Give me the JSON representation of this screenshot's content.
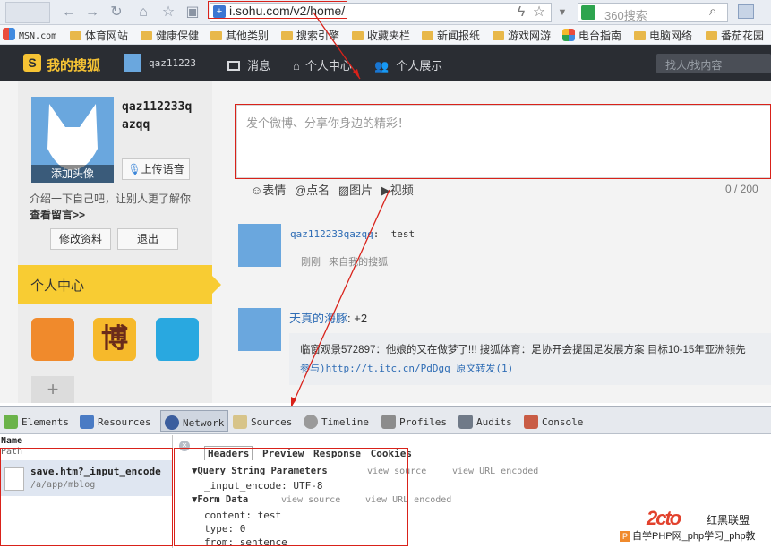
{
  "browser": {
    "url": "i.sohu.com/v2/home/",
    "search_placeholder": "360搜索"
  },
  "bookmarks": [
    "MSN.com",
    "体育网站",
    "健康保健",
    "其他类别",
    "搜索引擎",
    "收藏夹栏",
    "新闻报纸",
    "游戏网游",
    "电台指南",
    "电脑网络",
    "番茄花园"
  ],
  "sohu_nav": {
    "logo": "我的搜狐",
    "username": "qaz11223",
    "items": [
      "消息",
      "个人中心",
      "个人展示"
    ],
    "search_placeholder": "找人/找内容"
  },
  "profile": {
    "add_avatar": "添加头像",
    "name_line1": "qaz112233q",
    "name_line2": "azqq",
    "upload_voice": "上传语音",
    "intro": "介绍一下自己吧，让别人更了解你",
    "guestbook": "查看留言>>",
    "edit_profile": "修改资料",
    "logout": "退出",
    "personal_center": "个人中心"
  },
  "composer": {
    "placeholder": "发个微博、分享你身边的精彩！",
    "tools": [
      "表情",
      "点名",
      "图片",
      "视频"
    ],
    "count": "0 / 200"
  },
  "feed": [
    {
      "author": "qaz112233qazqq",
      "separator": ":",
      "text": "test",
      "time": "刚刚",
      "source": "来自我的搜狐"
    },
    {
      "author": "天真的海豚",
      "separator": ":",
      "text": "+2",
      "quote_line1": "临窗观景572897：他娘的又在做梦了!!!    搜狐体育：足协开会提国足发展方案 目标10-15年亚洲领先",
      "quote_line2": "参与)http://t.itc.cn/PdDgq  原文转发(1)"
    }
  ],
  "devtools": {
    "tabs": [
      "Elements",
      "Resources",
      "Network",
      "Sources",
      "Timeline",
      "Profiles",
      "Audits",
      "Console"
    ],
    "col_name": "Name",
    "col_path": "Path",
    "request_name": "save.htm?_input_encode",
    "request_path": "/a/app/mblog",
    "detail_tabs": [
      "Headers",
      "Preview",
      "Response",
      "Cookies"
    ],
    "qs_title": "Query String Parameters",
    "view_source": "view source",
    "view_url_encoded": "view URL encoded",
    "qs_param": "_input_encode: UTF-8",
    "form_title": "Form Data",
    "form_params": [
      "content: test",
      "type: 0",
      "from: sentence"
    ]
  },
  "watermark": {
    "logo_text": "红黑联盟",
    "caption": "自学PHP网_php学习_php教"
  },
  "colors": {
    "accent_red": "#d9221a",
    "nav_dark": "#2a2d33",
    "personal_yellow": "#f8cc33",
    "link_blue": "#2f6db5",
    "avatar_blue": "#6aa7de"
  }
}
